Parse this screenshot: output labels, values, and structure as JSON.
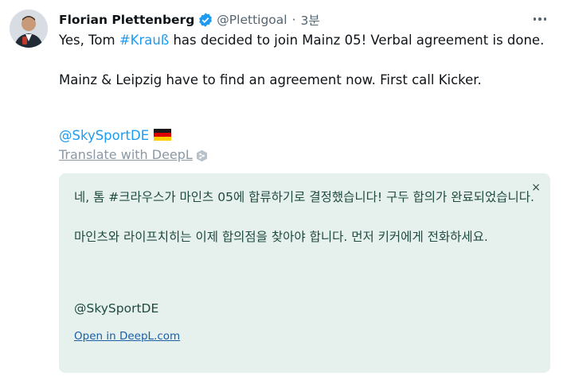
{
  "tweet": {
    "author_name": "Florian Plettenberg",
    "handle": "@Plettigoal",
    "separator": "·",
    "time": "3분",
    "text_a": "Yes, Tom ",
    "hashtag": "#Krauß",
    "text_b": " has decided to join Mainz 05! Verbal agreement is done.",
    "text_2": "Mainz & Leipzig have to find an agreement now. First call Kicker.",
    "mention": "@SkySportDE",
    "translate_label": "Translate with DeepL "
  },
  "translation": {
    "paragraph_1": "네, 톰 #크라우스가 마인츠 05에 합류하기로 결정했습니다! 구두 합의가 완료되었습니다.",
    "paragraph_2": "마인츠와 라이프치히는 이제 합의점을 찾아야 합니다. 먼저 키커에게 전화하세요.",
    "mention": "@SkySportDE",
    "link": "Open in DeepL.com",
    "close_symbol": "×"
  },
  "colors": {
    "accent": "#1d9bf0",
    "card_bg": "#e6f1ee",
    "card_text": "#1f4a3f"
  },
  "icons": [
    "verified-badge-icon",
    "more-icon",
    "germany-flag-icon",
    "deepl-icon",
    "close-icon"
  ]
}
